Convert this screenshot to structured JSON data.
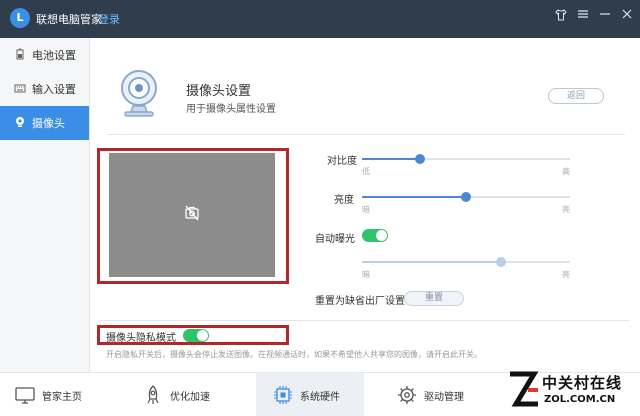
{
  "titlebar": {
    "logo_letter": "L",
    "app_title": "联想电脑管家",
    "login_label": "登录",
    "skin_icon": "shirt-icon",
    "menu_icon": "menu-icon",
    "minimize_icon": "minimize-icon",
    "close_icon": "close-icon"
  },
  "sidebar": {
    "items": [
      {
        "label": "电池设置",
        "icon": "battery-icon",
        "active": false
      },
      {
        "label": "输入设置",
        "icon": "keyboard-icon",
        "active": false
      },
      {
        "label": "摄像头",
        "icon": "camera-icon",
        "active": true
      }
    ]
  },
  "header": {
    "title": "摄像头设置",
    "subtitle": "用于摄像头属性设置",
    "back_label": "返回"
  },
  "preview": {
    "icon": "camera-off-icon"
  },
  "controls": {
    "contrast": {
      "label": "对比度",
      "min_label": "低",
      "max_label": "高",
      "value": 0.28
    },
    "brightness": {
      "label": "亮度",
      "min_label": "暗",
      "max_label": "亮",
      "value": 0.5
    },
    "auto_exposure": {
      "label": "自动曝光",
      "on": true
    },
    "exposure": {
      "min_label": "暗",
      "max_label": "亮",
      "value": 0.67,
      "disabled": true
    },
    "reset_label": "重置为缺省出厂设置",
    "reset_button": "重置"
  },
  "privacy": {
    "label": "摄像头隐私模式",
    "on": true,
    "note": "开启隐私开关后，摄像头会停止发送图像。在视频通话时，如果不希望他人共享您的图像，请开启此开关。"
  },
  "bottom_nav": [
    {
      "label": "管家主页",
      "icon": "monitor-icon",
      "active": false
    },
    {
      "label": "优化加速",
      "icon": "rocket-icon",
      "active": false
    },
    {
      "label": "系统硬件",
      "icon": "chip-icon",
      "active": true
    },
    {
      "label": "驱动管理",
      "icon": "gear-icon",
      "active": false
    }
  ],
  "watermark": {
    "big": "中关村在线",
    "small": "ZOL.COM.CN"
  },
  "colors": {
    "titlebar": "#2f3d4d",
    "accent": "#3a8ee6",
    "toggle_on": "#2ec46b",
    "highlight_box": "#b1272a"
  }
}
